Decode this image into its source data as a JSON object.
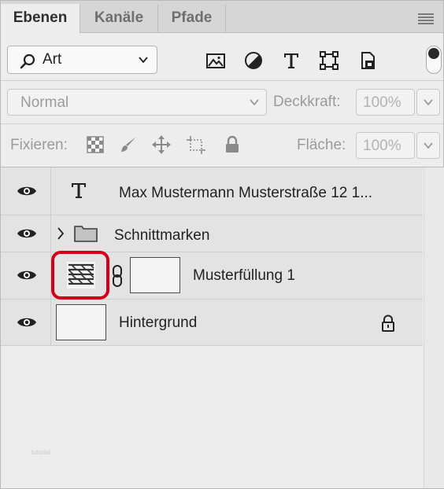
{
  "tabs": [
    {
      "label": "Ebenen",
      "active": true
    },
    {
      "label": "Kanäle",
      "active": false
    },
    {
      "label": "Pfade",
      "active": false
    }
  ],
  "filter": {
    "kind_value": "Art",
    "filter_icons": [
      "image-filter-icon",
      "adjustment-filter-icon",
      "type-filter-icon",
      "shape-filter-icon",
      "smart-object-filter-icon"
    ]
  },
  "blend": {
    "mode_value": "Normal",
    "opacity_label": "Deckkraft:",
    "opacity_value": "100%"
  },
  "lock": {
    "label": "Fixieren:",
    "fill_label": "Fläche:",
    "fill_value": "100%",
    "lock_icons": [
      "lock-transparent-icon",
      "lock-paint-icon",
      "lock-position-icon",
      "lock-artboard-icon",
      "lock-all-icon"
    ]
  },
  "layers": [
    {
      "name": "Max Mustermann Musterstraße 12 1...",
      "type": "text",
      "visible": true
    },
    {
      "name": "Schnittmarken",
      "type": "group",
      "visible": true,
      "collapsed": true
    },
    {
      "name": "Musterfüllung 1",
      "type": "pattern-fill",
      "visible": true,
      "highlighted": true
    },
    {
      "name": "Hintergrund",
      "type": "background",
      "visible": true,
      "locked": true
    }
  ],
  "colors": {
    "highlight": "#d0021b",
    "panel_bg": "#ededed",
    "layer_bg": "#e3e3e3"
  },
  "watermark": "tutorial"
}
